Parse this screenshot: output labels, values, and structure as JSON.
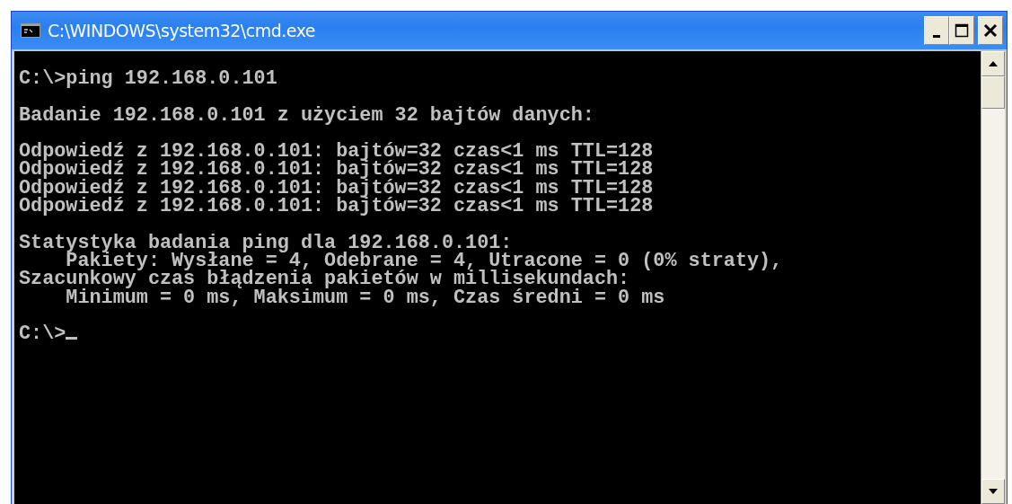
{
  "window": {
    "title": "C:\\WINDOWS\\system32\\cmd.exe"
  },
  "console": {
    "blocks": [
      [
        "C:\\>ping 192.168.0.101"
      ],
      [
        "Badanie 192.168.0.101 z użyciem 32 bajtów danych:"
      ],
      [
        "Odpowiedź z 192.168.0.101: bajtów=32 czas<1 ms TTL=128",
        "Odpowiedź z 192.168.0.101: bajtów=32 czas<1 ms TTL=128",
        "Odpowiedź z 192.168.0.101: bajtów=32 czas<1 ms TTL=128",
        "Odpowiedź z 192.168.0.101: bajtów=32 czas<1 ms TTL=128"
      ],
      [
        "Statystyka badania ping dla 192.168.0.101:",
        "    Pakiety: Wysłane = 4, Odebrane = 4, Utracone = 0 (0% straty),",
        "Szacunkowy czas błądzenia pakietów w millisekundach:",
        "    Minimum = 0 ms, Maksimum = 0 ms, Czas średni = 0 ms"
      ]
    ],
    "prompt": {
      "text": "C:\\>",
      "cursor": true
    }
  }
}
